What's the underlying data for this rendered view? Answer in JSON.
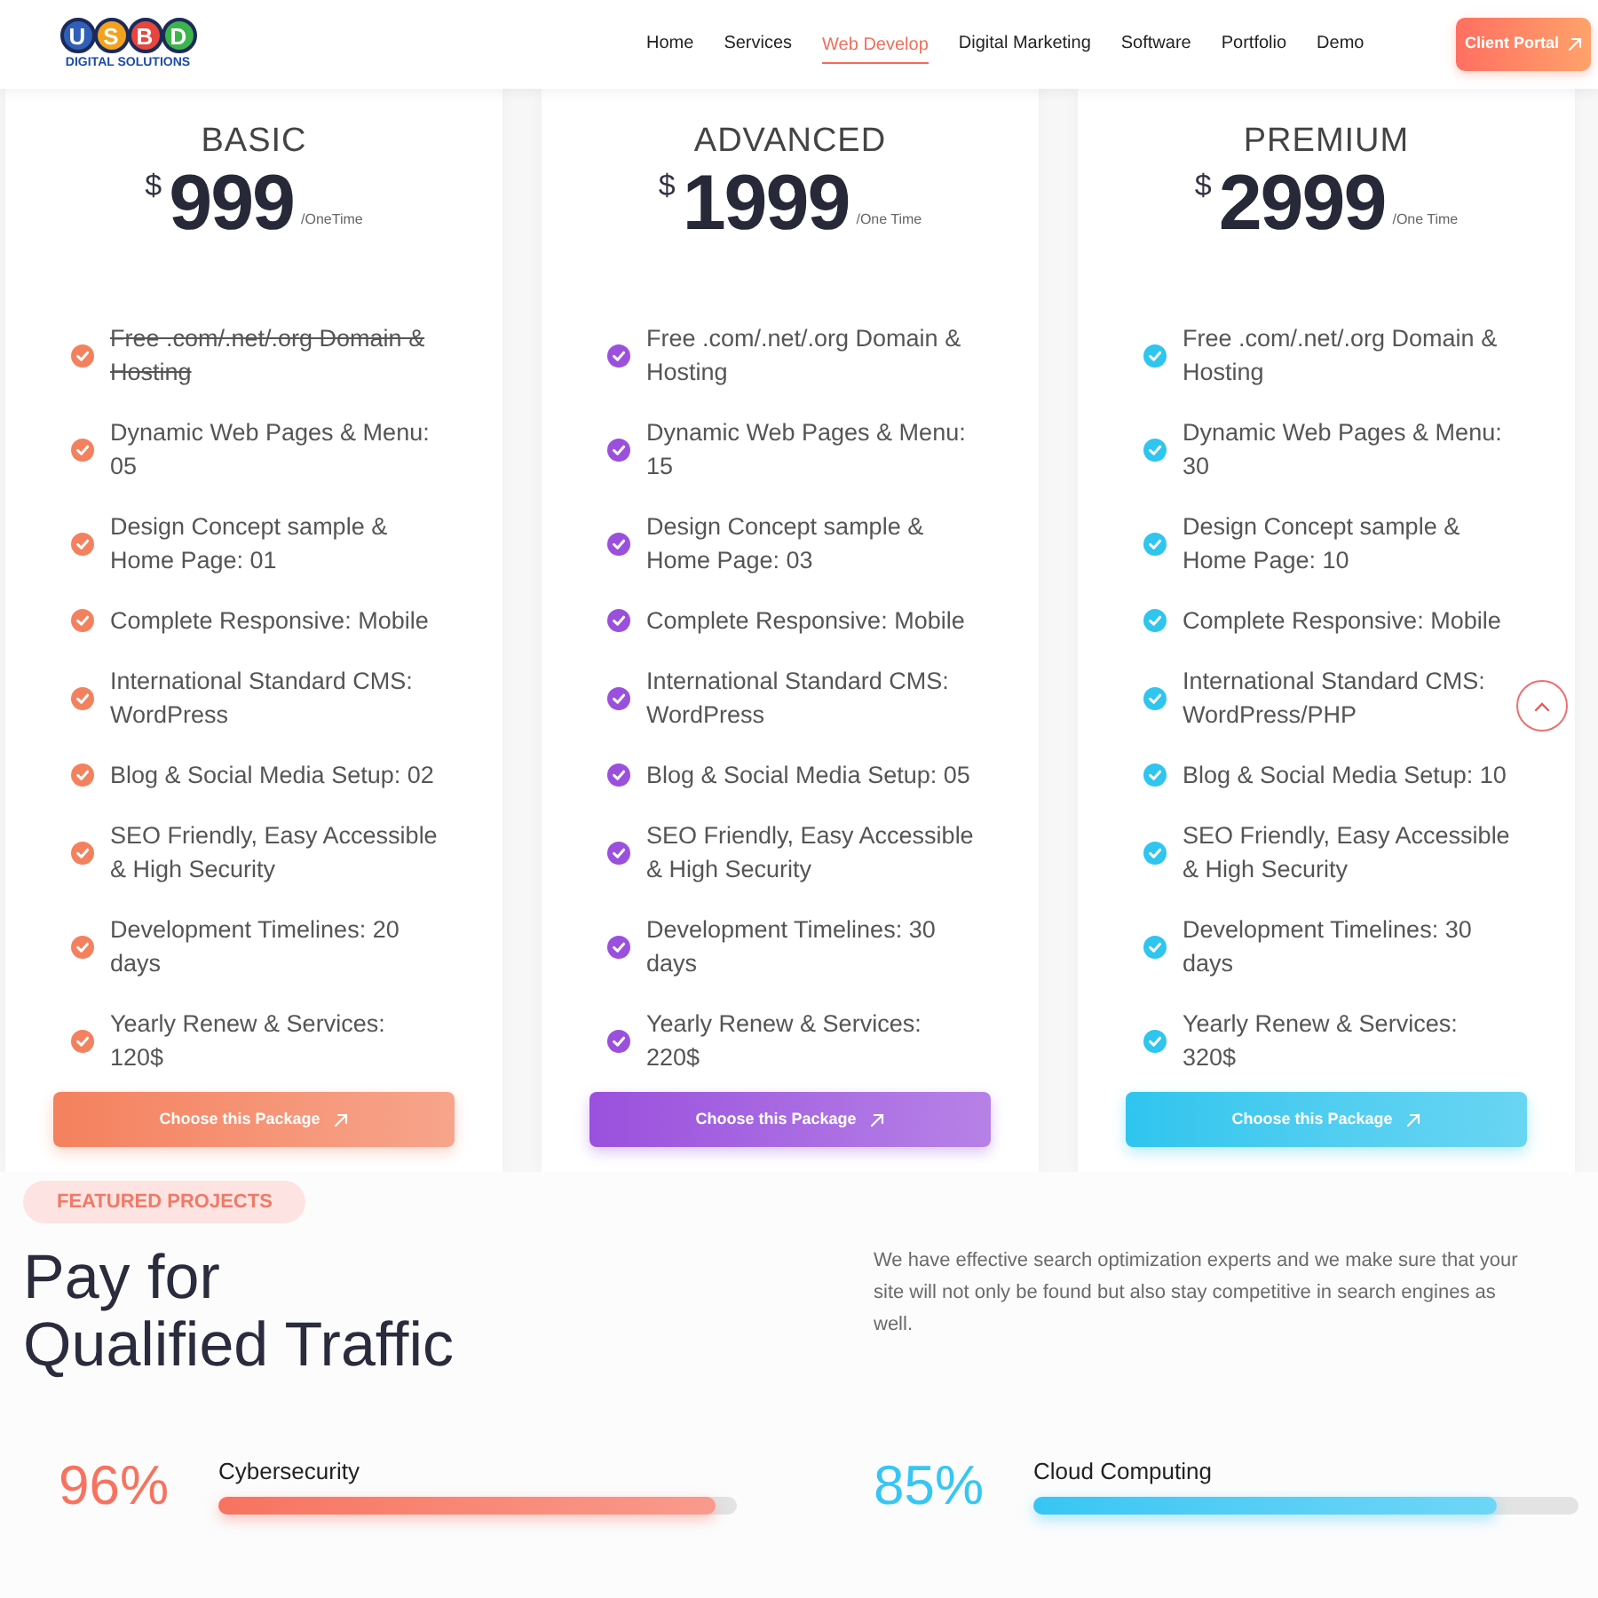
{
  "header": {
    "logo": {
      "letters": [
        {
          "text": "U",
          "color": "#2f5fb8"
        },
        {
          "text": "S",
          "color": "#f2a21d"
        },
        {
          "text": "B",
          "color": "#e8453c"
        },
        {
          "text": "D",
          "color": "#3bb54a"
        }
      ],
      "tagline": "DIGITAL SOLUTIONS"
    },
    "nav": [
      {
        "label": "Home",
        "selected": false
      },
      {
        "label": "Services",
        "selected": false
      },
      {
        "label": "Web Develop",
        "selected": true
      },
      {
        "label": "Digital Marketing",
        "selected": false
      },
      {
        "label": "Software",
        "selected": false
      },
      {
        "label": "Portfolio",
        "selected": false
      },
      {
        "label": "Demo",
        "selected": false
      }
    ],
    "client_portal": {
      "label": "Client Portal"
    }
  },
  "plans": [
    {
      "name": "BASIC",
      "currency": "$",
      "price": "999",
      "period": "/OneTime",
      "color": "#f4815e",
      "features": [
        {
          "text": "Free .com/.net/.org Domain & Hosting",
          "included": false
        },
        {
          "text": "Dynamic Web Pages & Menu: 05",
          "included": true
        },
        {
          "text": "Design Concept sample & Home Page: 01",
          "included": true
        },
        {
          "text": "Complete Responsive: Mobile",
          "included": true
        },
        {
          "text": "International Standard CMS: WordPress",
          "included": true
        },
        {
          "text": "Blog & Social Media Setup: 02",
          "included": true
        },
        {
          "text": "SEO Friendly, Easy Accessible & High Security",
          "included": true
        },
        {
          "text": "Development Timelines: 20 days",
          "included": true
        },
        {
          "text": "Yearly Renew & Services: 120$",
          "included": true
        }
      ],
      "button": "Choose this Package"
    },
    {
      "name": "ADVANCED",
      "currency": "$",
      "price": "1999",
      "period": "/One Time",
      "color": "#9a50dd",
      "features": [
        {
          "text": "Free .com/.net/.org Domain & Hosting",
          "included": true
        },
        {
          "text": "Dynamic Web Pages & Menu: 15",
          "included": true
        },
        {
          "text": "Design Concept sample & Home Page: 03",
          "included": true
        },
        {
          "text": "Complete Responsive: Mobile",
          "included": true
        },
        {
          "text": "International Standard CMS: WordPress",
          "included": true
        },
        {
          "text": "Blog & Social Media Setup: 05",
          "included": true
        },
        {
          "text": "SEO Friendly, Easy Accessible & High Security",
          "included": true
        },
        {
          "text": "Development Timelines: 30 days",
          "included": true
        },
        {
          "text": "Yearly Renew & Services: 220$",
          "included": true
        }
      ],
      "button": "Choose this Package"
    },
    {
      "name": "PREMIUM",
      "currency": "$",
      "price": "2999",
      "period": "/One Time",
      "color": "#2ec5ee",
      "features": [
        {
          "text": "Free .com/.net/.org Domain & Hosting",
          "included": true
        },
        {
          "text": "Dynamic Web Pages & Menu: 30",
          "included": true
        },
        {
          "text": "Design Concept sample & Home Page: 10",
          "included": true
        },
        {
          "text": "Complete Responsive: Mobile",
          "included": true
        },
        {
          "text": "International Standard CMS: WordPress/PHP",
          "included": true
        },
        {
          "text": "Blog & Social Media Setup: 10",
          "included": true
        },
        {
          "text": "SEO Friendly, Easy Accessible & High Security",
          "included": true
        },
        {
          "text": "Development Timelines: 30 days",
          "included": true
        },
        {
          "text": "Yearly Renew & Services: 320$",
          "included": true
        }
      ],
      "button": "Choose this Package"
    }
  ],
  "featured": {
    "badge": "FEATURED PROJECTS",
    "heading": "Pay for Qualified Traffic",
    "description": "We have effective search optimization experts and we make sure that your site will not only be found but also stay competitive in search engines as well.",
    "skills": [
      {
        "percent": "96%",
        "label": "Cybersecurity",
        "level": 0.96,
        "color": "#f7735f"
      },
      {
        "percent": "85%",
        "label": "Cloud Computing",
        "level": 0.85,
        "color": "#36c6f4"
      }
    ]
  }
}
